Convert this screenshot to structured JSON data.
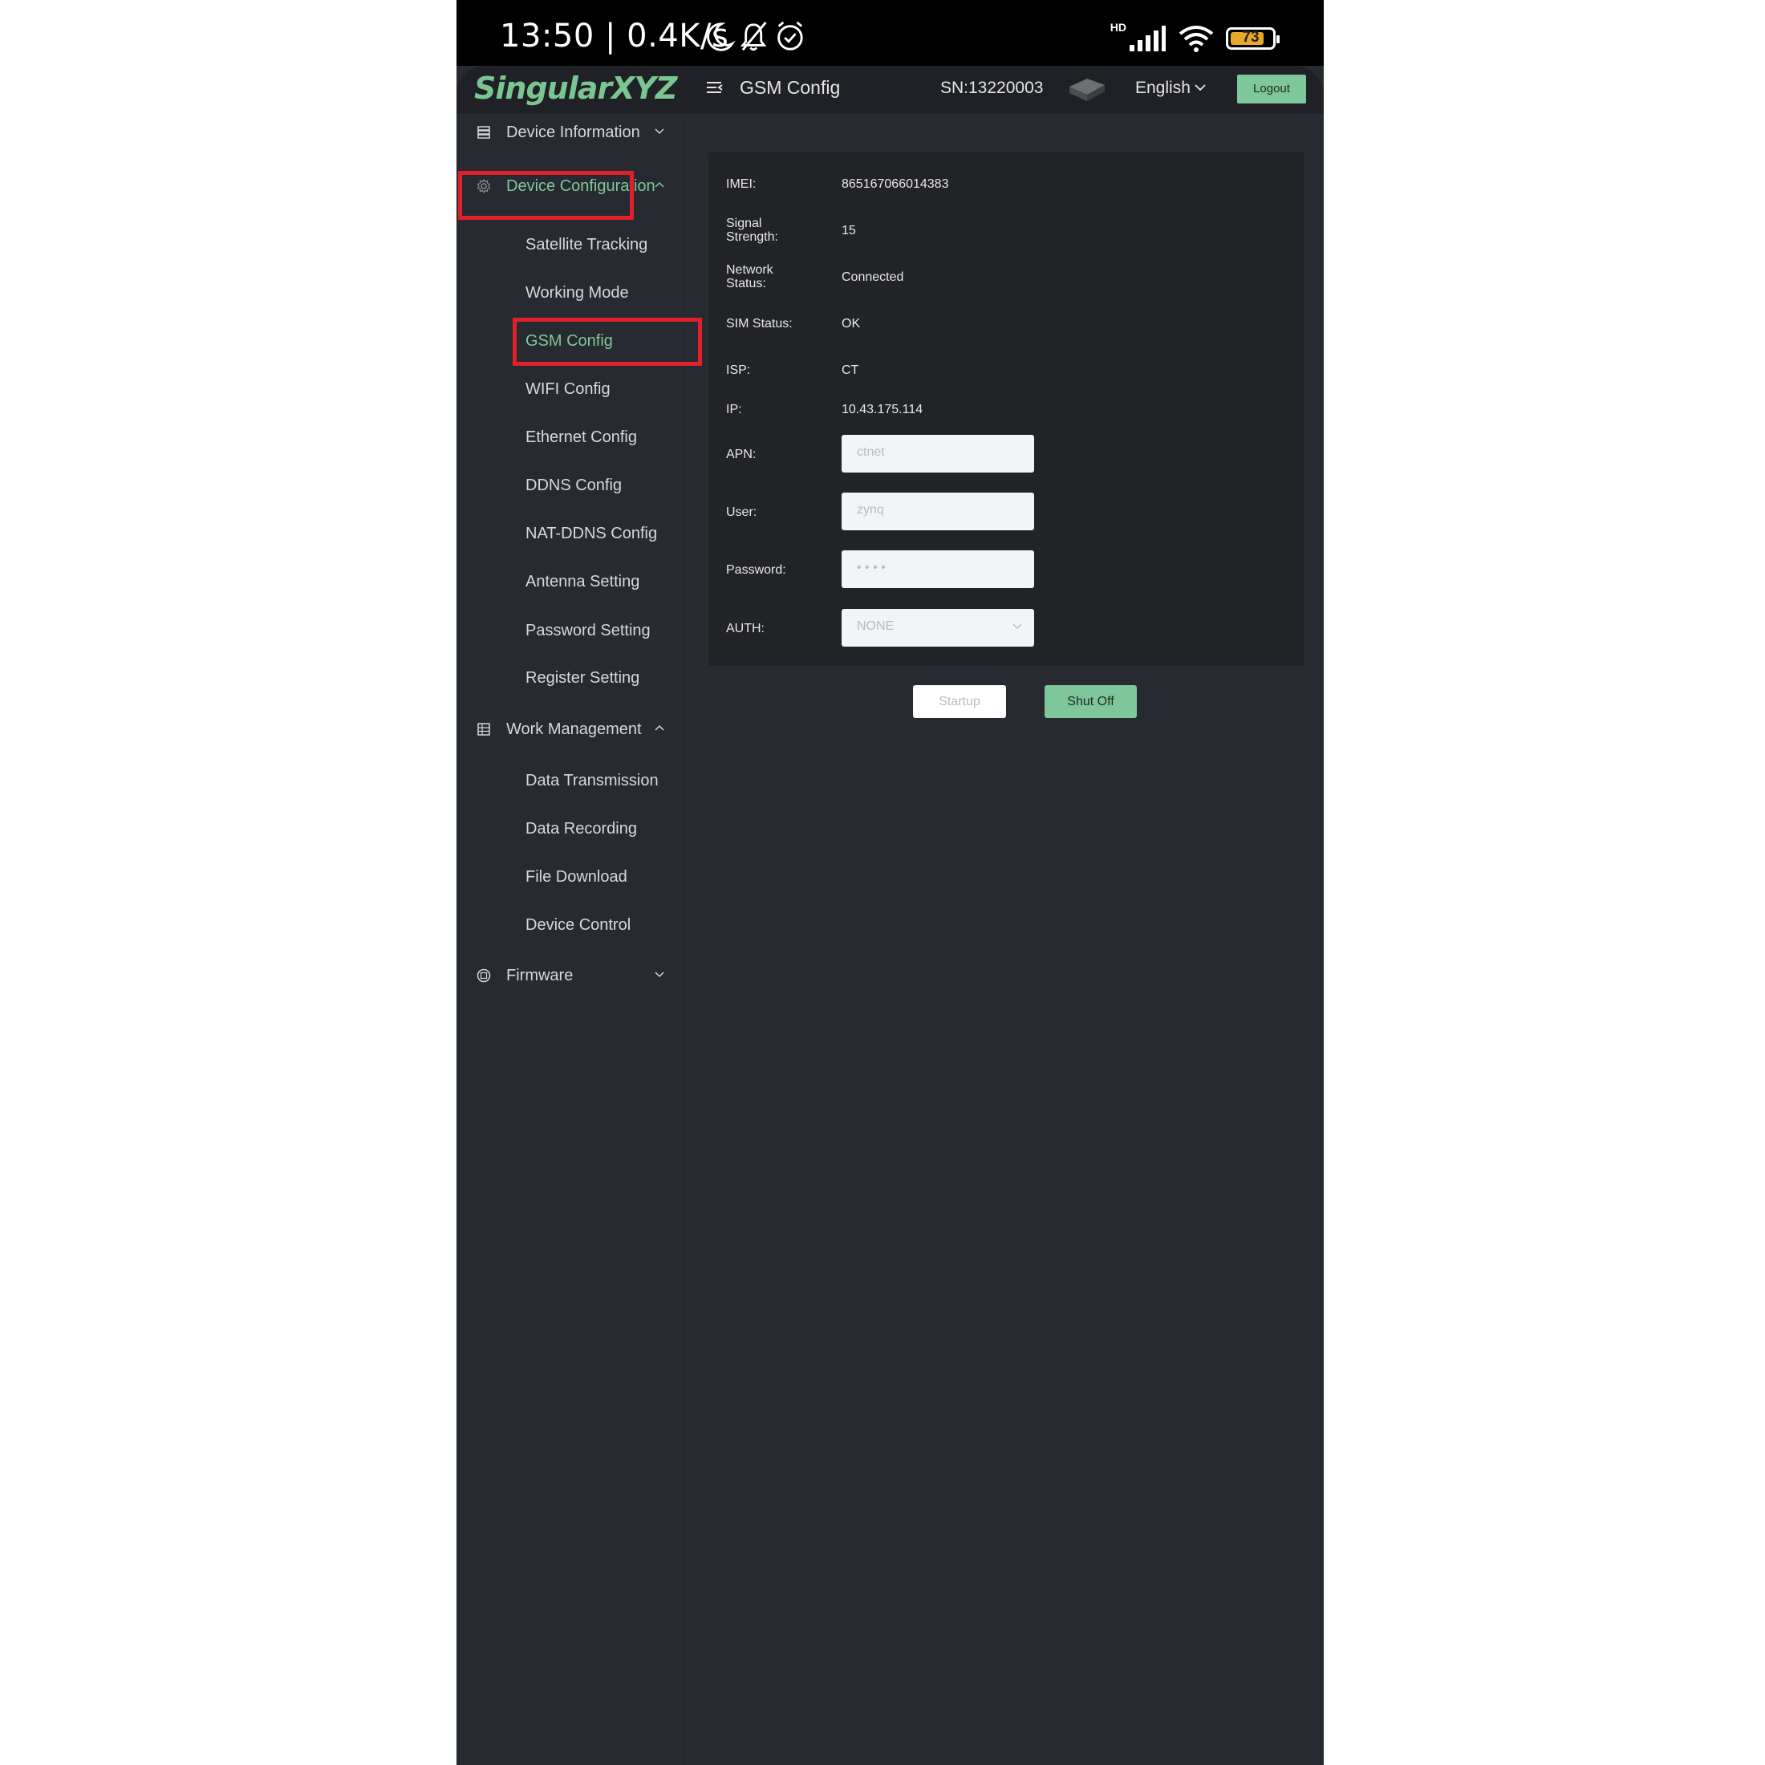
{
  "status_bar": {
    "time_speed": "13:50 | 0.4K/s",
    "network_label": "HD",
    "battery_level": "73",
    "battery_color": "#e6a72a"
  },
  "header": {
    "logo": "SingularXYZ",
    "page_title": "GSM Config",
    "serial": "SN:13220003",
    "language": "English",
    "logout_label": "Logout",
    "accent_color": "#7ec79a"
  },
  "sidebar": {
    "groups": [
      {
        "label": "Device Information",
        "icon": "server-icon",
        "expanded": false
      },
      {
        "label": "Device Configuration",
        "icon": "gear-icon",
        "expanded": true
      },
      {
        "label": "Work Management",
        "icon": "list-icon",
        "expanded": true
      },
      {
        "label": "Firmware",
        "icon": "chip-icon",
        "expanded": false
      }
    ],
    "config_items": [
      "Satellite Tracking",
      "Working Mode",
      "GSM Config",
      "WIFI Config",
      "Ethernet Config",
      "DDNS Config",
      "NAT-DDNS Config",
      "Antenna Setting",
      "Password Setting",
      "Register Setting"
    ],
    "work_items": [
      "Data Transmission",
      "Data Recording",
      "File Download",
      "Device Control"
    ]
  },
  "gsm": {
    "imei_label": "IMEI:",
    "imei": "865167066014383",
    "signal_label_1": "Signal",
    "signal_label_2": "Strength:",
    "signal": "15",
    "network_label_1": "Network",
    "network_label_2": "Status:",
    "network": "Connected",
    "sim_label": "SIM Status:",
    "sim": "OK",
    "isp_label": "ISP:",
    "isp": "CT",
    "ip_label": "IP:",
    "ip": "10.43.175.114",
    "apn_label": "APN:",
    "apn_placeholder": "ctnet",
    "user_label": "User:",
    "user_placeholder": "zynq",
    "password_label": "Password:",
    "password_value": "• • • •",
    "auth_label": "AUTH:",
    "auth_value": "NONE"
  },
  "actions": {
    "startup_label": "Startup",
    "shutoff_label": "Shut Off"
  }
}
